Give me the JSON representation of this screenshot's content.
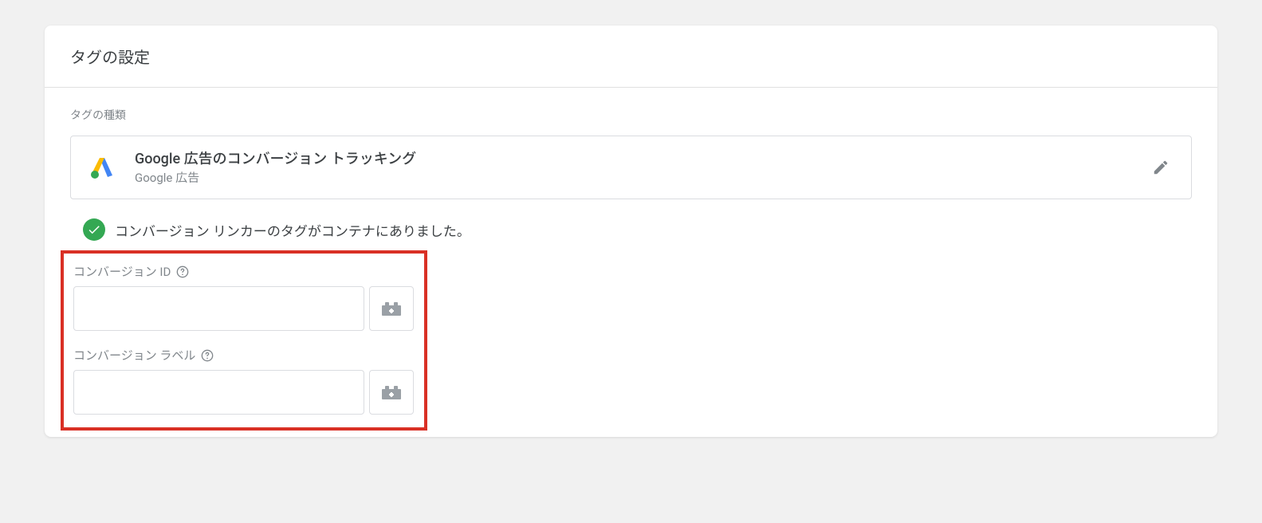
{
  "panel": {
    "title": "タグの設定"
  },
  "tag_type": {
    "section_label": "タグの種類",
    "title": "Google 広告のコンバージョン トラッキング",
    "subtitle": "Google 広告"
  },
  "status": {
    "message": "コンバージョン リンカーのタグがコンテナにありました。"
  },
  "fields": {
    "conversion_id": {
      "label": "コンバージョン ID",
      "value": ""
    },
    "conversion_label": {
      "label": "コンバージョン ラベル",
      "value": ""
    }
  }
}
